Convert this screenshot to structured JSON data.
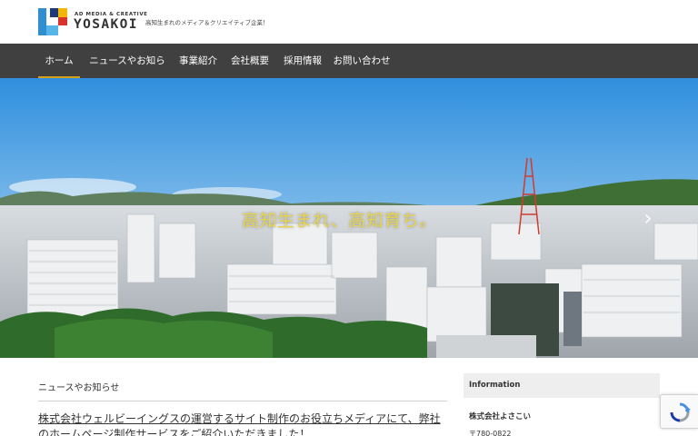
{
  "header": {
    "logo_small": "AD MEDIA & CREATIVE",
    "logo_big": "YOSAKOI",
    "tagline": "高知生まれのメディア＆クリエイティブ企業！"
  },
  "nav": {
    "items": [
      {
        "label": "ホーム",
        "active": true
      },
      {
        "label": "ニュースやお知らせ"
      },
      {
        "label": "事業紹介"
      },
      {
        "label": "会社概要"
      },
      {
        "label": "採用情報"
      },
      {
        "label": "お問い合わせ"
      }
    ]
  },
  "hero": {
    "caption": "高知生まれ、高知育ち。",
    "next_glyph": "›",
    "next_icon": "chevron-right-icon"
  },
  "news": {
    "heading": "ニュースやお知らせ",
    "items": [
      {
        "title": "株式会社ウェルビーイングスの運営するサイト制作のお役立ちメディアにて、弊社のホームページ制作サービスをご紹介いただきました！"
      }
    ]
  },
  "sidebar": {
    "info_title": "Information",
    "company_name": "株式会社よさこい",
    "postal": "〒780-0822"
  },
  "colors": {
    "nav_bg": "#404040",
    "nav_accent": "#d6a21b",
    "caption": "#e7d44a",
    "logo_blue": "#2f8fd0",
    "logo_yellow": "#f2b705",
    "logo_red": "#d9342b",
    "logo_navy": "#1e3a78"
  }
}
